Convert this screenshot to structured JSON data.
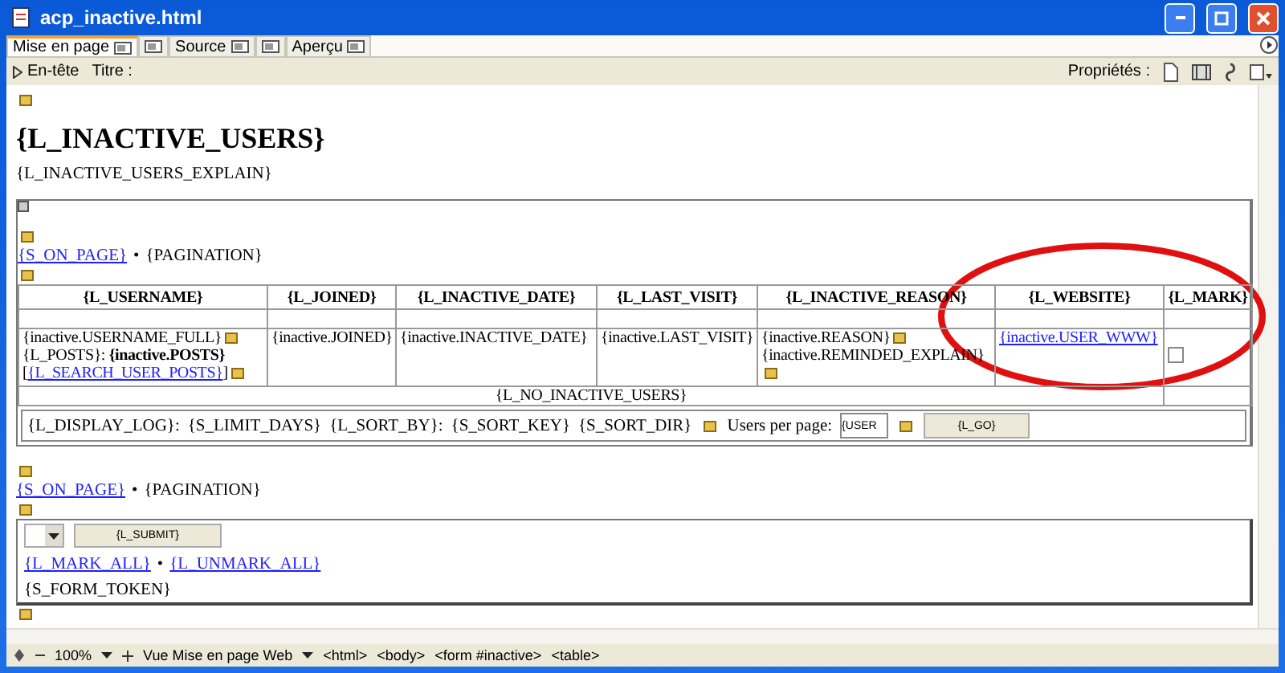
{
  "window": {
    "title": "acp_inactive.html"
  },
  "tabs": [
    {
      "label": "Mise en page",
      "selected": true
    },
    {
      "selected": false
    },
    {
      "label": "Source",
      "selected": false
    },
    {
      "selected": false
    },
    {
      "label": "Aperçu",
      "selected": false
    }
  ],
  "toolbar": {
    "header_toggle": "En-tête",
    "title_label": "Titre :",
    "properties_label": "Propriétés :"
  },
  "page": {
    "heading": "{L_INACTIVE_USERS}",
    "explain": "{L_INACTIVE_USERS_EXPLAIN}",
    "pagination_top": {
      "link": "{S_ON_PAGE}",
      "separator": "•",
      "text": "{PAGINATION}"
    },
    "table": {
      "columns": [
        "{L_USERNAME}",
        "{L_JOINED}",
        "{L_INACTIVE_DATE}",
        "{L_LAST_VISIT}",
        "{L_INACTIVE_REASON}",
        "{L_WEBSITE}",
        "{L_MARK}"
      ],
      "row": [
        {
          "lines": [
            [
              {
                "kind": "text",
                "text": "{inactive.USERNAME_FULL}"
              },
              {
                "kind": "marker"
              }
            ],
            [
              {
                "kind": "text",
                "text": "{L_POSTS}: **{inactive.POSTS}**"
              }
            ],
            [
              {
                "kind": "text",
                "text": "["
              },
              {
                "kind": "link",
                "text": "{L_SEARCH_USER_POSTS}"
              },
              {
                "kind": "text",
                "text": "]"
              },
              {
                "kind": "marker"
              }
            ]
          ]
        },
        {
          "lines": [
            [
              {
                "kind": "text",
                "text": "{inactive.JOINED}"
              }
            ]
          ]
        },
        {
          "lines": [
            [
              {
                "kind": "text",
                "text": "{inactive.INACTIVE_DATE}"
              }
            ]
          ]
        },
        {
          "lines": [
            [
              {
                "kind": "text",
                "text": "{inactive.LAST_VISIT}"
              }
            ]
          ]
        },
        {
          "lines": [
            [
              {
                "kind": "text",
                "text": "{inactive.REASON}"
              },
              {
                "kind": "marker"
              }
            ],
            [
              {
                "kind": "text",
                "text": "{inactive.REMINDED_EXPLAIN}"
              }
            ],
            [
              {
                "kind": "marker"
              }
            ]
          ]
        },
        {
          "lines": [
            [
              {
                "kind": "link",
                "text": "{inactive.USER_WWW}"
              }
            ]
          ]
        },
        {
          "lines": [
            [
              {
                "kind": "checkbox",
                "checked": false
              }
            ]
          ]
        }
      ],
      "empty_text": "{L_NO_INACTIVE_USERS}"
    },
    "filter": {
      "parts": [
        "{L_DISPLAY_LOG}:",
        "{S_LIMIT_DAYS}",
        "{L_SORT_BY}:",
        "{S_SORT_KEY}",
        "{S_SORT_DIR}"
      ],
      "per_page_label": "Users per page:",
      "per_page_value": "{USER",
      "go_button": "{L_GO}"
    },
    "pagination_bottom": {
      "link": "{S_ON_PAGE}",
      "separator": "•",
      "text": "{PAGINATION}"
    },
    "actions": {
      "submit_button": "{L_SUBMIT}",
      "mark_all": "{L_MARK_ALL}",
      "separator": "•",
      "unmark_all": "{L_UNMARK_ALL}",
      "form_token": "{S_FORM_TOKEN}"
    }
  },
  "status_bar": {
    "zoom": "100%",
    "view": "Vue Mise en page Web",
    "tags": [
      "<html>",
      "<body>",
      "<form #inactive>",
      "<table>"
    ]
  }
}
